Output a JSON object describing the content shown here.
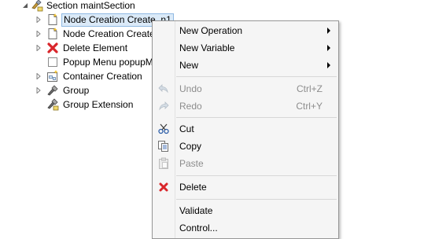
{
  "tree": {
    "root": {
      "label": "Section maintSection",
      "expanded": true,
      "icon": "section-icon"
    },
    "children": [
      {
        "label": "Node Creation Create_n1",
        "icon": "node-creation-icon",
        "has_children": true,
        "selected": true
      },
      {
        "label": "Node Creation Create",
        "icon": "node-creation-icon",
        "has_children": true,
        "selected": false
      },
      {
        "label": "Delete Element",
        "icon": "delete-element-icon",
        "has_children": true,
        "selected": false
      },
      {
        "label": "Popup Menu popupM",
        "icon": "popup-menu-icon",
        "has_children": false,
        "selected": false
      },
      {
        "label": "Container Creation",
        "icon": "container-creation-icon",
        "has_children": true,
        "selected": false
      },
      {
        "label": "Group",
        "icon": "group-icon",
        "has_children": true,
        "selected": false
      },
      {
        "label": "Group Extension",
        "icon": "group-extension-icon",
        "has_children": false,
        "selected": false
      }
    ]
  },
  "context_menu": {
    "items": [
      {
        "label": "New Operation",
        "submenu": true,
        "enabled": true
      },
      {
        "label": "New Variable",
        "submenu": true,
        "enabled": true
      },
      {
        "label": "New",
        "submenu": true,
        "enabled": true
      },
      {
        "label": "Undo",
        "shortcut": "Ctrl+Z",
        "enabled": false,
        "icon": "undo-icon"
      },
      {
        "label": "Redo",
        "shortcut": "Ctrl+Y",
        "enabled": false,
        "icon": "redo-icon"
      },
      {
        "label": "Cut",
        "enabled": true,
        "icon": "cut-icon"
      },
      {
        "label": "Copy",
        "enabled": true,
        "icon": "copy-icon"
      },
      {
        "label": "Paste",
        "enabled": false,
        "icon": "paste-icon"
      },
      {
        "label": "Delete",
        "enabled": true,
        "icon": "delete-icon"
      },
      {
        "label": "Validate",
        "enabled": true
      },
      {
        "label": "Control...",
        "enabled": true
      }
    ]
  },
  "colors": {
    "selection_bg": "#dbeaf8",
    "selection_border": "#90b9e2",
    "menu_bg": "#f5f5f5",
    "disabled_text": "#8d8d8d",
    "delete_red": "#d9262b"
  }
}
